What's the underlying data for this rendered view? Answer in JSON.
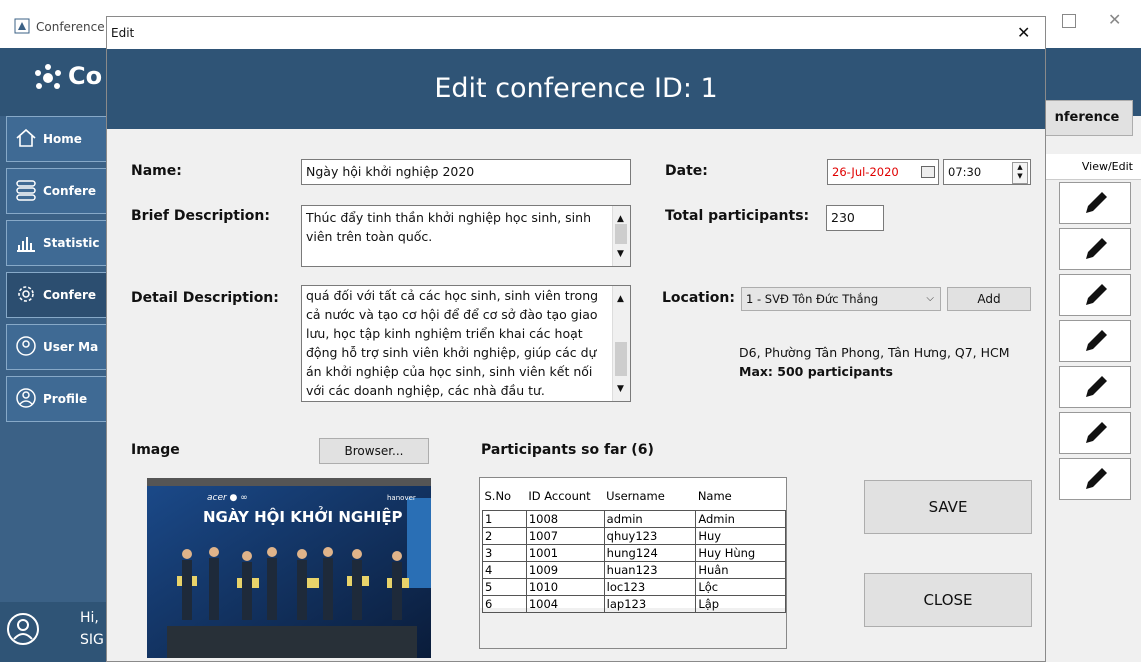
{
  "main_window": {
    "title": "Conference",
    "header_text": "Co",
    "sidebar": [
      {
        "label": "Home"
      },
      {
        "label": "Confere"
      },
      {
        "label": "Statistic"
      },
      {
        "label": "Confere"
      },
      {
        "label": "User Ma"
      },
      {
        "label": "Profile"
      }
    ],
    "user_hi": "Hi,",
    "user_sign": "SIG",
    "add_conference_btn": "nference",
    "view_edit_header": "View/Edit",
    "edit_rows": 7
  },
  "dialog": {
    "window_title": "Edit",
    "close_glyph": "✕",
    "header": "Edit conference ID: 1",
    "name_label": "Name:",
    "name_value": "Ngày hội khởi nghiệp 2020",
    "brief_label": "Brief Description:",
    "brief_value": "Thúc đẩy tinh thần khởi nghiệp học sinh, sinh viên trên toàn quốc.",
    "detail_label": "Detail Description:",
    "detail_value": "quá đối với tất cả các học sinh, sinh viên trong cả nước và tạo cơ hội để để cơ sở đào tạo giao lưu, học tập kinh nghiệm triển khai các hoạt động hỗ trợ sinh viên khởi nghiệp, giúp các dự án khởi nghiệp của học sinh, sinh viên kết nối với các doanh nghiệp, các nhà đầu tư.",
    "date_label": "Date:",
    "date_value": "26-Jul-2020",
    "time_value": "07:30",
    "participants_label": "Total participants:",
    "participants_value": "230",
    "location_label": "Location:",
    "location_value": "1 - SVĐ Tôn Đức Thắng",
    "add_button": "Add",
    "address": "D6, Phường Tân Phong, Tân Hưng, Q7, HCM",
    "max": "Max: 500 participants",
    "image_label": "Image",
    "browser_button": "Browser...",
    "participants_title": "Participants so far (6)",
    "table": {
      "headers": [
        "S.No",
        "ID Account",
        "Username",
        "Name"
      ],
      "rows": [
        [
          "1",
          "1008",
          "admin",
          "Admin"
        ],
        [
          "2",
          "1007",
          "qhuy123",
          "Huy"
        ],
        [
          "3",
          "1001",
          "hung124",
          "Huy Hùng"
        ],
        [
          "4",
          "1009",
          "huan123",
          "Huân"
        ],
        [
          "5",
          "1010",
          "loc123",
          "Lộc"
        ],
        [
          "6",
          "1004",
          "lap123",
          "Lập"
        ]
      ]
    },
    "save_button": "SAVE",
    "close_button": "CLOSE",
    "photo_banner": "NGÀY HỘI KHỞI NGHIỆP"
  },
  "colors": {
    "header": "#2f5476",
    "sidebar": "#3b6186",
    "date_text": "#e00000"
  }
}
